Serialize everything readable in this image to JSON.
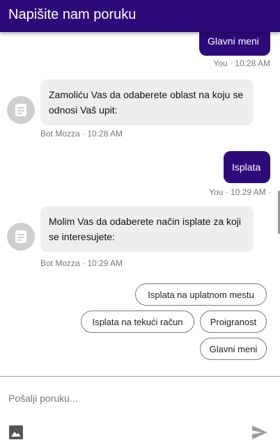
{
  "header": {
    "title": "Napišite nam poruku"
  },
  "messages": {
    "user_1": {
      "text": "Glavni meni",
      "meta": "You · 10:28 AM"
    },
    "bot_1": {
      "text": "Zamoliću Vas da odaberete oblast na koju se odnosi Vaš upit:",
      "meta": "Bot Mozza · 10:28 AM"
    },
    "user_2": {
      "text": "Isplata",
      "meta": "You · 10:29 AM ·"
    },
    "bot_2": {
      "text": "Molim Vas da odaberete način isplate za koji se interesujete:",
      "meta": "Bot Mozza · 10:29 AM"
    }
  },
  "quick_replies": {
    "option_1": "Isplata na uplatnom mestu",
    "option_2": "Isplata na tekući račun",
    "option_3": "Proigranost",
    "option_4": "Glavni meni"
  },
  "composer": {
    "placeholder": "Pošalji poruku...",
    "value": ""
  },
  "icons": {
    "bot_avatar": "document-icon",
    "image": "image-icon",
    "send": "send-icon"
  },
  "colors": {
    "brand": "#2d0a7a",
    "bot_bubble": "#eeeeee",
    "avatar": "#cfcfcf"
  }
}
